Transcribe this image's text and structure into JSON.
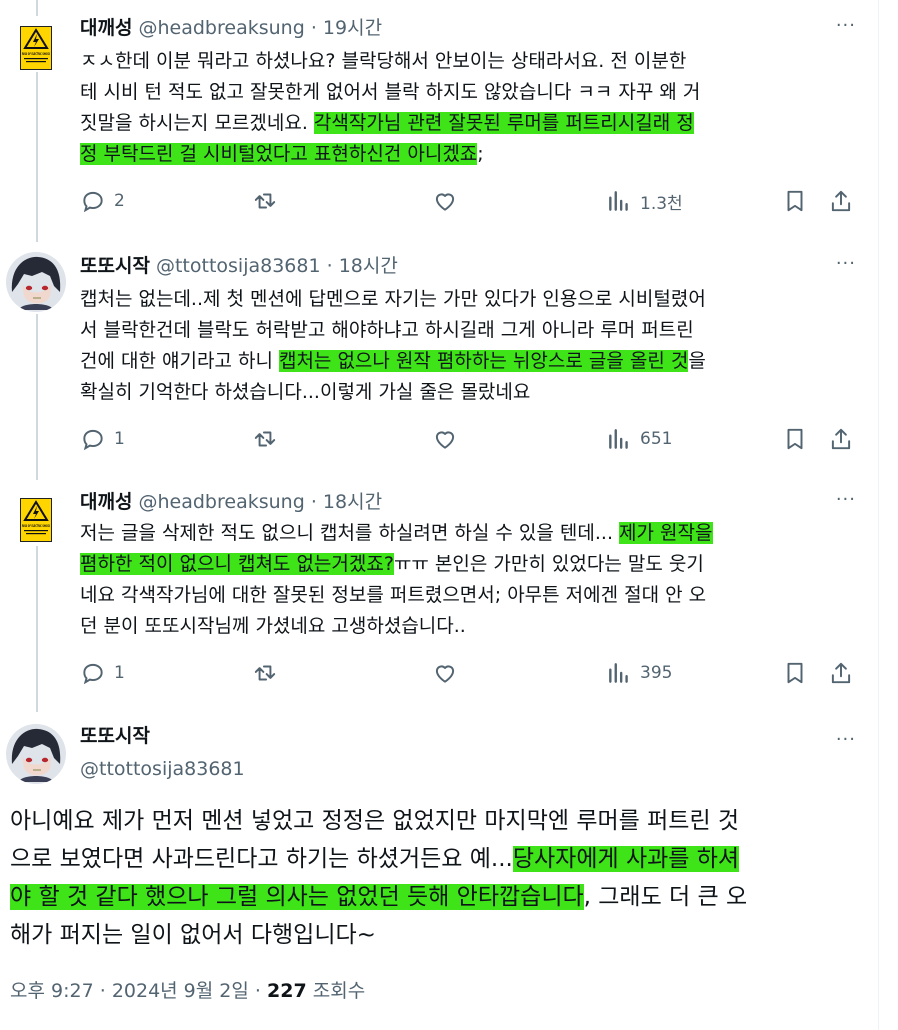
{
  "tweets": [
    {
      "name": "대깨성",
      "handle": "@headbreaksung",
      "time": "19시간",
      "avatar": "electric-shock-warning-sign",
      "avatar_text": "RISK OF ELECTRIC SHOCK",
      "body_plain": "ㅈㅅ한데 이분 뭐라고 하셨나요? 블락당해서 안보이는 상태라서요. 전 이분한\n테 시비 턴 적도 없고 잘못한게 없어서 블락 하지도 않았습니다 ㅋㅋ 자꾸 왜 거\n짓말을 하시는지 모르겠네요. ",
      "body_highlight": "각색작가님 관련 잘못된 루머를 퍼트리시길래 정\n정 부탁드린 걸 시비털었다고 표현하신건 아니겠죠",
      "body_tail": ";",
      "replies": "2",
      "views": "1.3천"
    },
    {
      "name": "또또시작",
      "handle": "@ttottosija83681",
      "time": "18시간",
      "avatar": "anime-character",
      "body_plain": "캡처는 없는데..제 첫 멘션에 답멘으로 자기는 가만 있다가 인용으로 시비털렸어\n서 블락한건데 블락도 허락받고 해야하냐고 하시길래 그게 아니라 루머 퍼트린\n건에 대한 얘기라고 하니 ",
      "body_highlight": "캡처는 없으나 원작 폄하하는 뉘앙스로 글을 올린 것",
      "body_tail": "을\n확실히 기억한다 하셨습니다...이렇게 가실 줄은 몰랐네요",
      "replies": "1",
      "views": "651"
    },
    {
      "name": "대깨성",
      "handle": "@headbreaksung",
      "time": "18시간",
      "avatar": "electric-shock-warning-sign",
      "avatar_text": "RISK OF ELECTRIC SHOCK",
      "body_plain": "저는 글을 삭제한 적도 없으니 캡처를 하실려면 하실 수 있을 텐데... ",
      "body_highlight": "제가 원작을\n폄하한 적이 없으니 캡쳐도 없는거겠죠?",
      "body_tail": "ㅠㅠ 본인은 가만히 있었다는 말도 웃기\n네요 각색작가님에 대한 잘못된 정보를 퍼트렸으면서; 아무튼 저에겐 절대 안 오\n던 분이 또또시작님께 가셨네요 고생하셨습니다..",
      "replies": "1",
      "views": "395"
    }
  ],
  "main_tweet": {
    "name": "또또시작",
    "handle": "@ttottosija83681",
    "avatar": "anime-character",
    "body_plain": "아니예요 제가 먼저 멘션 넣었고 정정은 없었지만 마지막엔 루머를 퍼트린 것\n으로 보였다면 사과드린다고 하기는 하셨거든요 예...",
    "body_highlight": "당사자에게 사과를 하셔\n야 할 것 같다 했으나 그럴 의사는 없었던 듯해 안타깝습니다",
    "body_tail": ", 그래도 더 큰 오\n해가 퍼지는 일이 없어서 다행입니다~",
    "time": "오후 9:27",
    "date": "2024년 9월 2일",
    "views_count": "227",
    "views_label": "조회수"
  },
  "ui": {
    "sep": "·",
    "more": "···"
  },
  "colors": {
    "highlight": "#3ee417",
    "secondary_text": "#536471",
    "thread_line": "#cfd9de"
  }
}
